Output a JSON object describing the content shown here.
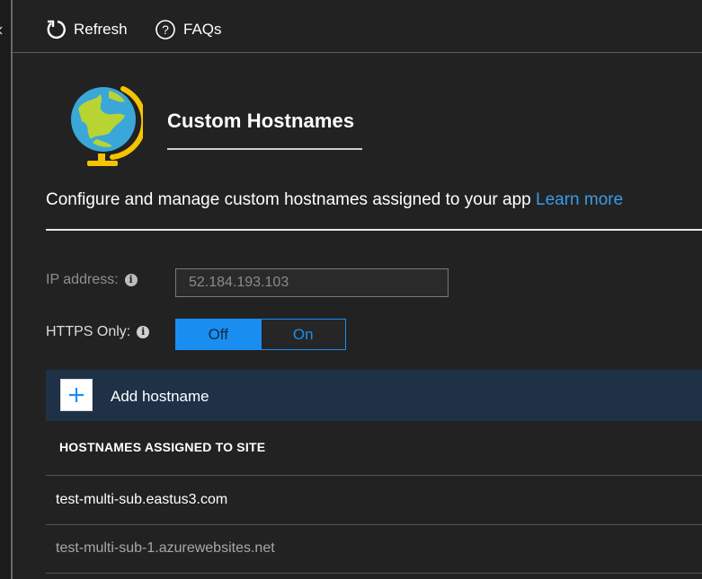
{
  "toolbar": {
    "refresh_label": "Refresh",
    "faqs_label": "FAQs",
    "refresh_icon": "refresh-icon",
    "faqs_icon": "question-circle-icon"
  },
  "header": {
    "title": "Custom Hostnames",
    "icon": "globe-icon"
  },
  "description": {
    "text": "Configure and manage custom hostnames assigned to your app ",
    "link_label": "Learn more"
  },
  "ip_address": {
    "label": "IP address:",
    "value": "52.184.193.103"
  },
  "https_only": {
    "label": "HTTPS Only:",
    "options": [
      "Off",
      "On"
    ],
    "selected": "Off"
  },
  "add_hostname": {
    "label": "Add hostname"
  },
  "hostnames_table": {
    "header": "HOSTNAMES ASSIGNED TO SITE",
    "rows": [
      "test-multi-sub.eastus3.com",
      "test-multi-sub-1.azurewebsites.net"
    ]
  },
  "colors": {
    "accent": "#1a8ef0",
    "link": "#3a9be6",
    "add_bar_bg": "#1e3147",
    "page_bg": "#222222"
  }
}
